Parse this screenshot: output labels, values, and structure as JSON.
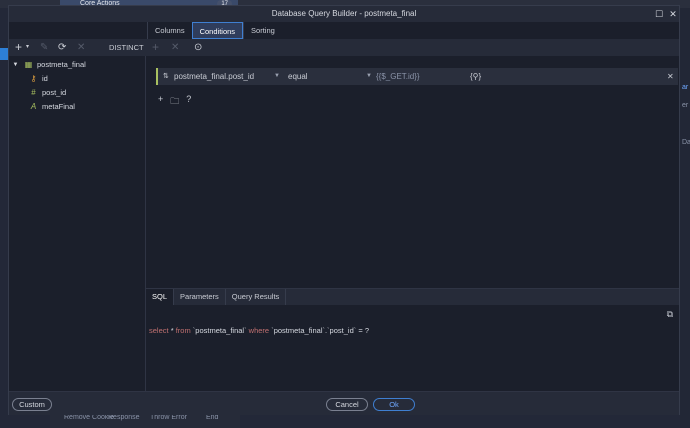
{
  "background": {
    "panel_title": "Core Actions",
    "panel_count": "17",
    "right_snippets": [
      "ar",
      "er",
      "Da"
    ],
    "bottom_labels": [
      "Remove Cookie",
      "Response",
      "Throw Error",
      "End"
    ]
  },
  "window": {
    "title": "Database Query Builder - postmeta_final"
  },
  "tabs": [
    "Columns",
    "Conditions",
    "Sorting"
  ],
  "toolbar": {
    "distinct_label": "DISTINCT"
  },
  "tree": {
    "table": "postmeta_final",
    "columns": [
      {
        "name": "id",
        "icon": "key-icon"
      },
      {
        "name": "post_id",
        "icon": "hash-icon"
      },
      {
        "name": "metaFinal",
        "icon": "text-type-icon"
      }
    ]
  },
  "condition": {
    "field": "postmeta_final.post_id",
    "operator": "equal",
    "value": "{{$_GET.id}}",
    "binding_glyph": "{⚲}"
  },
  "bottom_tabs": [
    "SQL",
    "Parameters",
    "Query Results"
  ],
  "sql": {
    "select": "select",
    "star": "*",
    "from": "from",
    "table": "`postmeta_final`",
    "where": "where",
    "column": "`postmeta_final`.`post_id`",
    "eq": "=",
    "param": "?"
  },
  "footer": {
    "custom_label": "Custom",
    "cancel_label": "Cancel",
    "ok_label": "Ok"
  },
  "colors": {
    "accent": "#3f7fd1",
    "condition_marker": "#a8c060",
    "sql_keyword": "#c07070"
  }
}
